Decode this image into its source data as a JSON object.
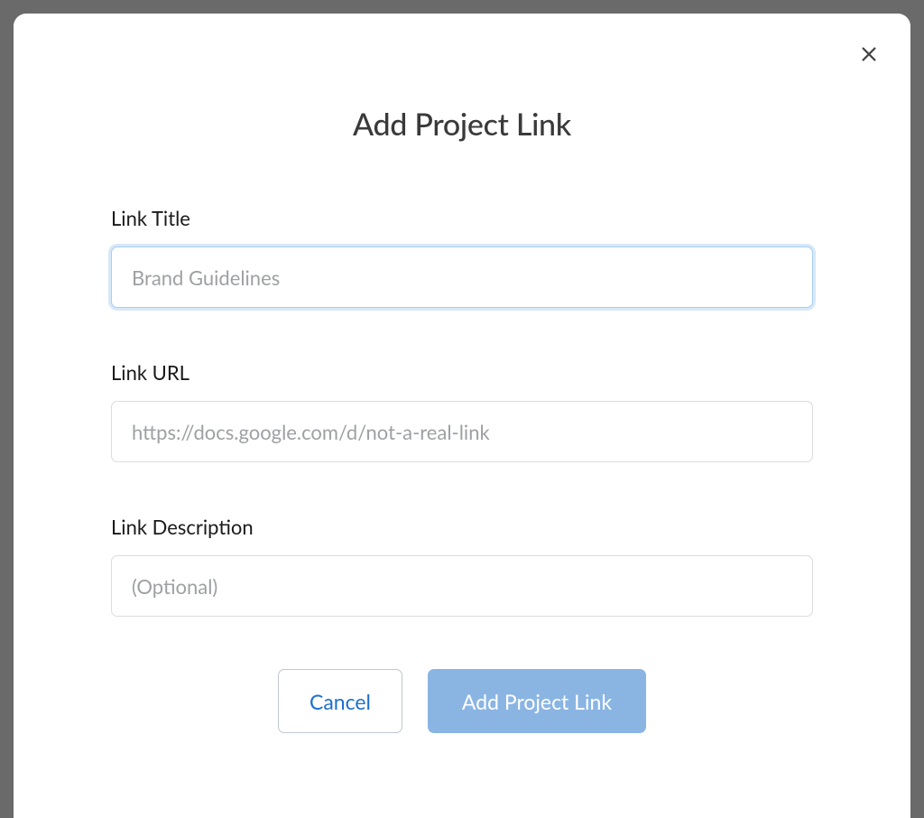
{
  "modal": {
    "title": "Add Project Link",
    "fields": {
      "link_title": {
        "label": "Link Title",
        "placeholder": "Brand Guidelines",
        "value": ""
      },
      "link_url": {
        "label": "Link URL",
        "placeholder": "https://docs.google.com/d/not-a-real-link",
        "value": ""
      },
      "link_description": {
        "label": "Link Description",
        "placeholder": "(Optional)",
        "value": ""
      }
    },
    "buttons": {
      "cancel": "Cancel",
      "submit": "Add Project Link"
    }
  }
}
